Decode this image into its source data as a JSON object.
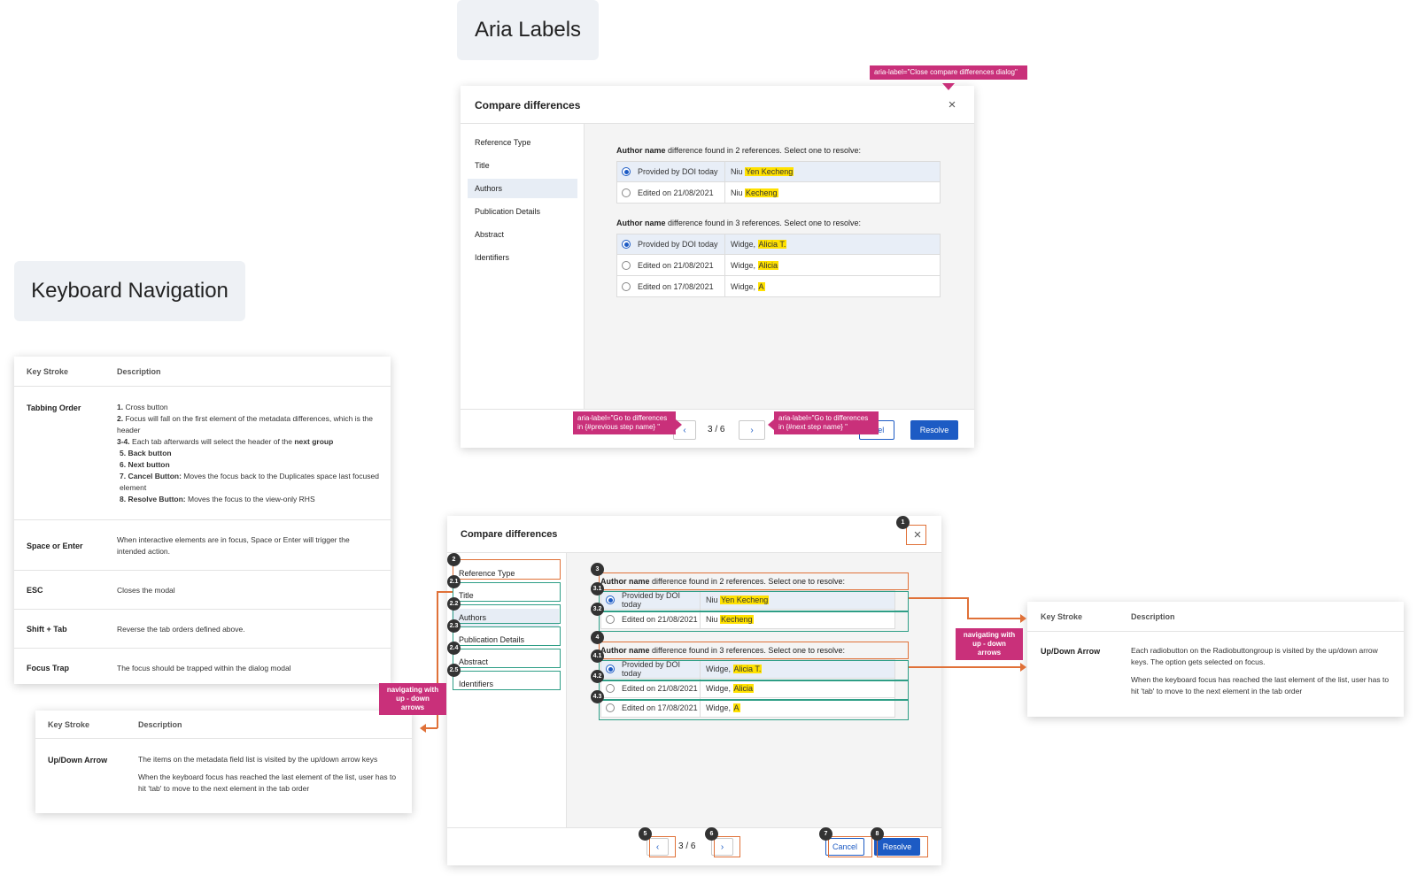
{
  "aria_section": {
    "label": "Aria Labels",
    "dialog": {
      "title": "Compare differences",
      "close": "×",
      "sidebar": [
        "Reference Type",
        "Title",
        "Authors",
        "Publication Details",
        "Abstract",
        "Identifiers"
      ],
      "selected_sidebar": "Authors",
      "groups": [
        {
          "title_bold": "Author name",
          "title_rest": " difference found in 2 references. Select one to resolve:",
          "rows": [
            {
              "source": "Provided by DOI today",
              "prefix": "Niu ",
              "highlight": "Yen Kecheng",
              "selected": true
            },
            {
              "source": "Edited on 21/08/2021",
              "prefix": "Niu ",
              "highlight": "Kecheng",
              "selected": false
            }
          ]
        },
        {
          "title_bold": "Author name",
          "title_rest": " difference found in 3 references. Select one to resolve:",
          "rows": [
            {
              "source": "Provided by DOI today",
              "prefix": "Widge, ",
              "highlight": "Alicia T.",
              "selected": true
            },
            {
              "source": "Edited on 21/08/2021",
              "prefix": "Widge, ",
              "highlight": "Alicia",
              "selected": false
            },
            {
              "source": "Edited on 17/08/2021",
              "prefix": "Widge, ",
              "highlight": "A",
              "selected": false
            }
          ]
        }
      ],
      "prev": "‹",
      "next": "›",
      "counter": "3 / 6",
      "cancel_visible": "ncel",
      "resolve": "Resolve"
    },
    "tags": {
      "close": "aria-label=\"Close compare differences dialog\"",
      "prev_line1": "aria-label=\"Go to differences",
      "prev_line2": "in {#previous step name} \"",
      "next_line1": "aria-label=\"Go to differences",
      "next_line2": "in {#next step name} \""
    }
  },
  "keyboard_section": {
    "label": "Keyboard Navigation",
    "table": {
      "head_key": "Key Stroke",
      "head_desc": "Description",
      "rows": [
        {
          "key": "Tabbing Order",
          "lines": [
            {
              "num": "1.",
              "text": "Cross button"
            },
            {
              "num": "2.",
              "text": "Focus will fall on the first element of the metadata differences, which is the header"
            },
            {
              "num": "3-4.",
              "text": "Each tab afterwards will select the header of the ",
              "bold": "next group"
            },
            {
              "num": "5.",
              "bold": "Back button"
            },
            {
              "num": "6.",
              "bold": "Next button"
            },
            {
              "num": "7.",
              "bold": "Cancel Button:",
              "text": " Moves the focus back to the Duplicates space last focused element"
            },
            {
              "num": "8.",
              "bold": "Resolve Button:",
              "text": " Moves the focus to the view-only RHS"
            }
          ]
        },
        {
          "key": "Space or Enter",
          "desc": "When interactive elements are in focus, Space or Enter will trigger the intended action."
        },
        {
          "key": "ESC",
          "desc": "Closes the modal"
        },
        {
          "key": "Shift + Tab",
          "desc": "Reverse the tab orders defined above."
        },
        {
          "key": "Focus Trap",
          "desc": "The focus should be trapped within the dialog modal"
        }
      ]
    },
    "left_note": {
      "head_key": "Key Stroke",
      "head_desc": "Description",
      "key": "Up/Down Arrow",
      "desc1": "The items on the metadata field list is visited by the up/down arrow keys",
      "desc2": "When the keyboard focus has reached the last element of the list, user has to hit 'tab' to move to the next element in the tab order"
    },
    "right_note": {
      "head_key": "Key Stroke",
      "head_desc": "Description",
      "key": "Up/Down Arrow",
      "desc1": "Each radiobutton on the Radiobuttongroup is visited by the up/down arrow keys. The option gets selected on focus.",
      "desc2": "When the keyboard focus has reached the last element of the list, user has to hit 'tab' to move to the next element in the tab order"
    },
    "nav_tag_line1": "navigating with",
    "nav_tag_line2": "up - down arrows",
    "dialog": {
      "title": "Compare differences",
      "close": "×",
      "prev": "‹",
      "next": "›",
      "counter": "3 / 6",
      "cancel": "Cancel",
      "resolve": "Resolve"
    },
    "badges": [
      "1",
      "2",
      "2.1",
      "2.2",
      "2.3",
      "2.4",
      "2.5",
      "3",
      "3.1",
      "3.2",
      "4",
      "4.1",
      "4.2",
      "4.3",
      "5",
      "6",
      "7",
      "8"
    ],
    "colors": {
      "focus_orange": "#e07138",
      "focus_green": "#2e9e86",
      "tag_pink": "#c9307a",
      "primary_blue": "#1d5bc4",
      "highlight": "#ffe100"
    }
  }
}
